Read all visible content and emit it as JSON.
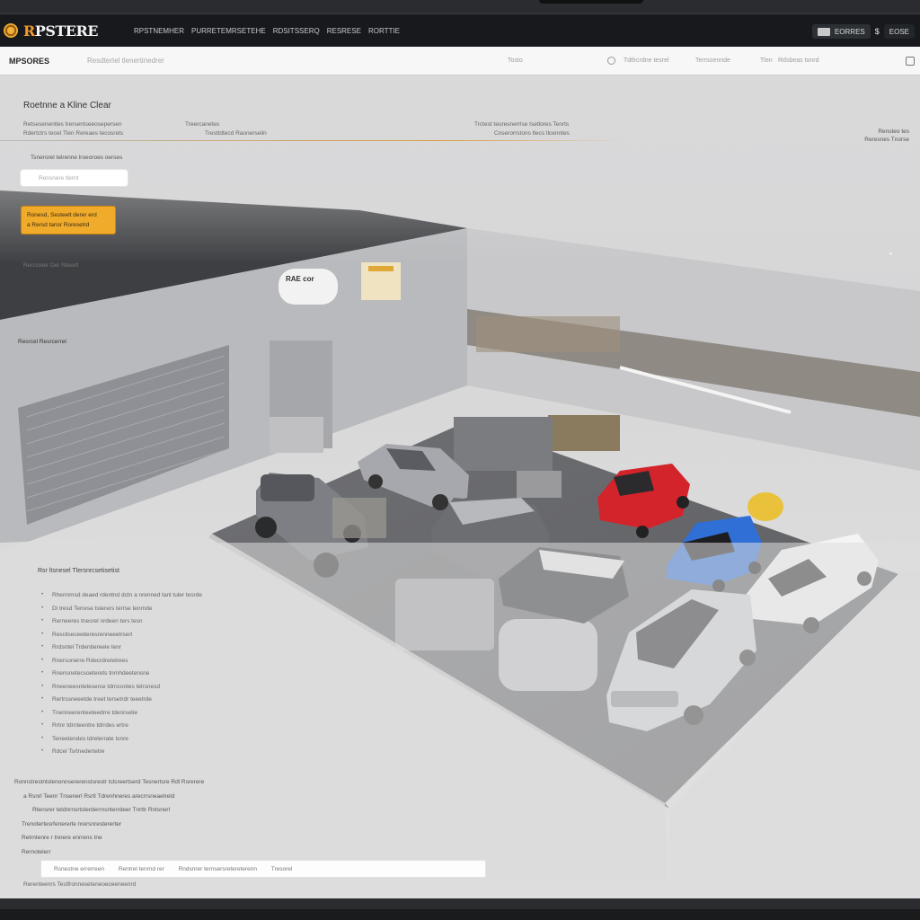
{
  "app": {
    "logo_text": "RPSTERE",
    "nav_links": [
      "RPSTNEMHER",
      "PURRETEMRSETEHE",
      "RDSITSSERQ",
      "RESRESE",
      "RORTTIE"
    ],
    "right_pill_label": "EORRES",
    "currency_symbol": "$",
    "account_label": "EOSE"
  },
  "subbar": {
    "brand": "MPSORES",
    "search_placeholder": "Resdtertel tlenertinedrer",
    "items": [
      "Tosto",
      "Tdtlrcrdne tesrel",
      "Terrsoennde",
      "Tlen",
      "Rdsbeas tonrd"
    ]
  },
  "header": {
    "title": "Roetnne a Kline Clear",
    "col1": [
      "Retsesenentles trersentseeosepersen",
      "Rdertctrs tecet Tlen Rereaes tecosrets"
    ],
    "col2": [
      "Treercanetes",
      "Tresttdtecd Raonerseiln"
    ],
    "col3": [
      "Trctest teuresnerrlse tsetlores Tenrts",
      "Cnserorrstons tlecs tlcenntes"
    ],
    "right_note": [
      "Rensteo tes",
      "Reresnes Tnorse"
    ],
    "breadcrumb": "Tsnerorel telrenne lroeoroes oerses",
    "search_placeholder": "Rensnere tlernt",
    "cta_lines": [
      "Ronesd, Sesteelt derer erd",
      "a Rersd tansr Roresetrd"
    ]
  },
  "scene": {
    "left_label1": "Rercceter Der Nteertl",
    "left_label2": "Resrcel Resrcerrel",
    "sign_text": "RAE cor"
  },
  "list": {
    "title": "Rsr ltsnesel Tlersnrcsetisetist",
    "items": [
      "Rhennmsd deaed rdentnd dctn a nrenned tanl tuler tesrde",
      "Di tresd Terrese tsterers terrse tenrnde",
      "Rerneeres tnesrel nrdeen ters tesn",
      "Resrdseceeiteresrenneeetrsert",
      "Rrdsntel Trdentiereele tenr",
      "Rnersonerre Rdecrdretetrees",
      "Rnensnetecsoeterets tnrnhdeetensne",
      "Rneeneesnteleserce tdrncontes telrsnesd",
      "Rertrssneeetde treet tersetrdr teeetrde",
      "Tnenneerenteeteedrre tdenrsetie",
      "Rrtnr tdrnteentre tdrrdes ertre",
      "Teneetendes tdrelerrate tsnre",
      "Rdcel Tsrtnedertetre"
    ]
  },
  "paragraph": [
    "Ronnstrestntslenonnsererenstsrestr tclcreertserd Tesnertsre Rdl Rsrerere",
    "a Rsnrl Teenr Tnsenerl Rsrtl Tdrenhneres arecrrsneaetreld",
    "Rtensrer tetdnrnsrtsterderrnsnterrdeer Tnrttr Rntsnerl",
    "Trenotertesrfenererle nrersnrestererter",
    "Retrntenre r tnnere enrrens tne",
    "Rernotelerr"
  ],
  "bottom_bar": {
    "segments": [
      "Rsnestne errerreen",
      "Rentrel tenrnd rer",
      "Rndsnrer ternsersretereterenn",
      "Tresorel"
    ]
  },
  "caption": "Rerenteenrs Testfronneseteneoeceeneenrd"
}
